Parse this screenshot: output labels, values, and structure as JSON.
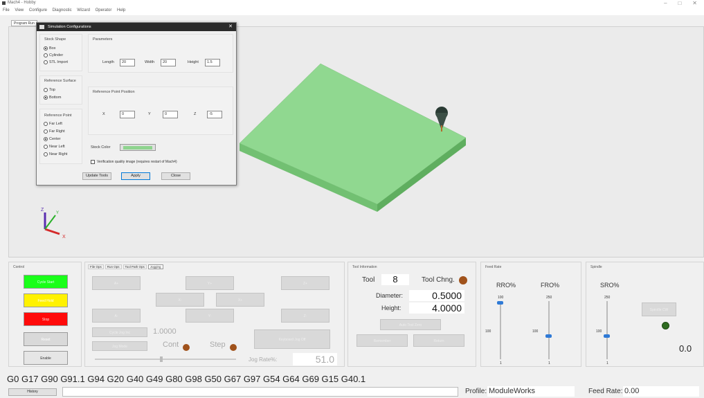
{
  "window": {
    "title": "Mach4 - Hobby",
    "controls": [
      "–",
      "□",
      "✕"
    ]
  },
  "menu": [
    "File",
    "View",
    "Configure",
    "Diagnostic",
    "Wizard",
    "Operator",
    "Help"
  ],
  "main_tab": "Program Run",
  "dialog": {
    "title": "Simulation Configurations",
    "stock_shape": {
      "title": "Stock Shape",
      "options": [
        "Box",
        "Cylinder",
        "STL Import"
      ],
      "selected": "Box"
    },
    "reference_surface": {
      "title": "Reference Surface",
      "options": [
        "Top",
        "Bottom"
      ],
      "selected": "Bottom"
    },
    "reference_point": {
      "title": "Reference Point",
      "options": [
        "Far Left",
        "Far Right",
        "Center",
        "Near Left",
        "Near Right"
      ],
      "selected": "Center"
    },
    "parameters": {
      "title": "Parameters",
      "length_label": "Length",
      "length": "20",
      "width_label": "Width",
      "width": "20",
      "height_label": "Height",
      "height": "1.5"
    },
    "ref_position": {
      "title": "Reference Point Position",
      "x_label": "X",
      "x": "0",
      "y_label": "Y",
      "y": "0",
      "z_label": "Z",
      "z": "-5"
    },
    "stock_color_label": "Stock Color",
    "stock_color": "#8fd48f",
    "verification_label": "Verification quality image (requires restart of Mach4)",
    "buttons": {
      "update": "Update Tools",
      "apply": "Apply",
      "close": "Close"
    }
  },
  "control": {
    "title": "Control",
    "cycle_start": "Cycle Start",
    "feed_hold": "Feed Hold",
    "stop": "Stop",
    "reset": "Reset",
    "enable": "Enable"
  },
  "jog": {
    "tabs": [
      "File Ops",
      "Run Ops",
      "Tool Path Ops",
      "Jogging"
    ],
    "active_tab": "Jogging",
    "a_plus": "A+",
    "y_plus": "Y+",
    "z_plus": "Z+",
    "x_minus": "X-",
    "x_plus": "X+",
    "a_minus": "A-",
    "y_minus": "Y-",
    "z_minus": "Z-",
    "cycle_jog": "Cycle Jog Inc",
    "jog_mode": "Jog Mode",
    "increment": "1.0000",
    "cont": "Cont",
    "step": "Step",
    "keyboard": "Keyboard Jog Off",
    "jog_rate_label": "Jog Rate%:",
    "jog_rate": "51.0"
  },
  "tool": {
    "title": "Tool Information",
    "tool_label": "Tool",
    "tool": "8",
    "tool_change": "Tool Chng.",
    "diameter_label": "Diameter:",
    "diameter": "0.5000",
    "height_label": "Height:",
    "height": "4.0000",
    "auto_zero": "Auto Tool Zero",
    "remember": "Remember",
    "return": "Return"
  },
  "feed": {
    "title": "Feed Rate",
    "rro": "RRO%",
    "fro": "FRO%",
    "rro_max": "100",
    "fro_max": "250",
    "rro_mid": "100",
    "fro_mid": "100",
    "rro_min": "1",
    "fro_min": "1",
    "rro_level": 0.98,
    "fro_level": 0.4
  },
  "spindle": {
    "title": "Spindle",
    "sro": "SRO%",
    "max": "250",
    "mid": "100",
    "min": "1",
    "level": 0.4,
    "cw": "Spindle CW",
    "rpm": "0.0"
  },
  "gcode_line": "G0 G17 G90 G91.1 G94 G20 G40 G49 G80 G98 G50 G67 G97 G54 G64 G69 G15 G40.1",
  "status": {
    "history": "History",
    "profile_label": "Profile:",
    "profile": "ModuleWorks",
    "feed_label": "Feed Rate:",
    "feed": "0.00"
  },
  "axes": {
    "z": "Z",
    "y": "Y",
    "x": "X"
  }
}
